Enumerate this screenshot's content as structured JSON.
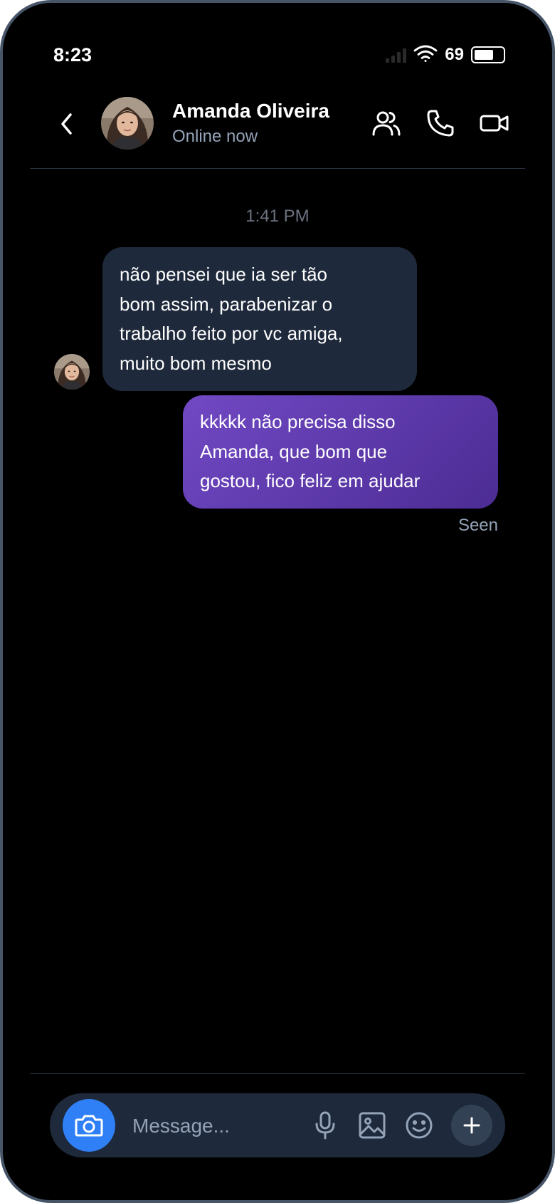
{
  "status_bar": {
    "time": "8:23",
    "battery_percent": "69",
    "battery_level": 0.69
  },
  "header": {
    "contact_name": "Amanda Oliveira",
    "contact_status": "Online now"
  },
  "conversation": {
    "timestamp": "1:41 PM",
    "incoming": {
      "lines": [
        "não pensei que ia ser tão",
        "bom assim, parabenizar o",
        "trabalho feito por vc amiga,",
        "muito bom mesmo"
      ]
    },
    "outgoing": {
      "lines": [
        "kkkkk não precisa disso",
        "Amanda, que bom que",
        "gostou, fico feliz em ajudar"
      ]
    },
    "seen_label": "Seen"
  },
  "composer": {
    "placeholder": "Message..."
  },
  "colors": {
    "accent_blue": "#2f80f7",
    "outgoing_bubble_start": "#7149c4",
    "outgoing_bubble_end": "#4c2c94",
    "incoming_bubble": "#1e293b"
  },
  "icons": {
    "back": "chevron-left-icon",
    "group": "users-icon",
    "call": "phone-icon",
    "video": "video-icon",
    "camera": "camera-icon",
    "mic": "microphone-icon",
    "gallery": "image-icon",
    "emoji": "smiley-icon",
    "more": "plus-icon"
  }
}
